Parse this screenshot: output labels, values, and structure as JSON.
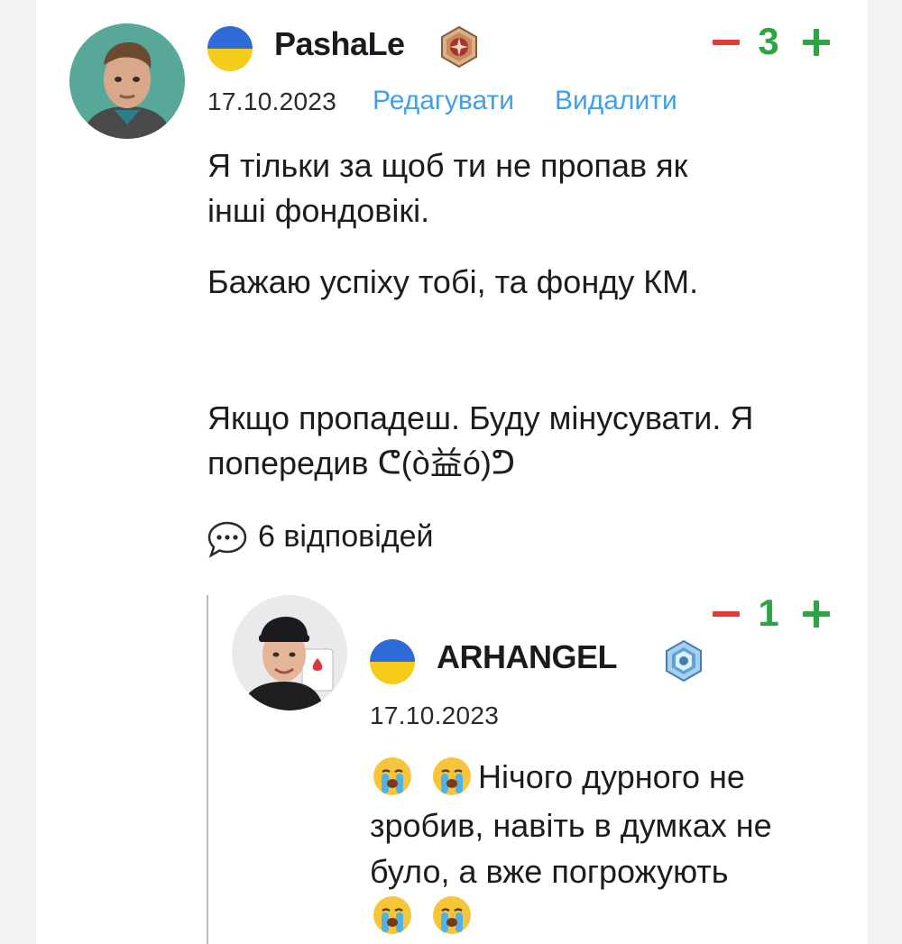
{
  "comment": {
    "username": "PashaLe",
    "flag_icon": "ukraine-flag-icon",
    "rank_icon": "rank-badge-bronze-icon",
    "date": "17.10.2023",
    "edit_label": "Редагувати",
    "delete_label": "Видалити",
    "score": "3",
    "body": [
      "Я тільки за щоб ти не пропав як",
      "інші фондовікі.",
      "Бажаю успіху тобі, та фонду КМ.",
      "Якщо пропадеш. Буду мінусувати. Я",
      "попередив ᕦ(ò益ó)ᕤ"
    ],
    "replies_label": "6 відповідей",
    "replies_icon": "comment-bubble-icon"
  },
  "reply": {
    "username": "ARHANGEL",
    "flag_icon": "ukraine-flag-icon",
    "rank_icon": "rank-badge-blue-icon",
    "date": "17.10.2023",
    "score": "1",
    "body_line1": "Нічого дурного не",
    "body_line2": "зробив, навіть в думках не",
    "body_line3": "було, а вже погрожують",
    "emoji": "crying-face-icon"
  },
  "colors": {
    "accent_link": "#3ea0e8",
    "vote_up": "#2da543",
    "vote_down": "#e53935",
    "flag_blue": "#2f6bd8",
    "flag_yellow": "#f6cc1a"
  }
}
